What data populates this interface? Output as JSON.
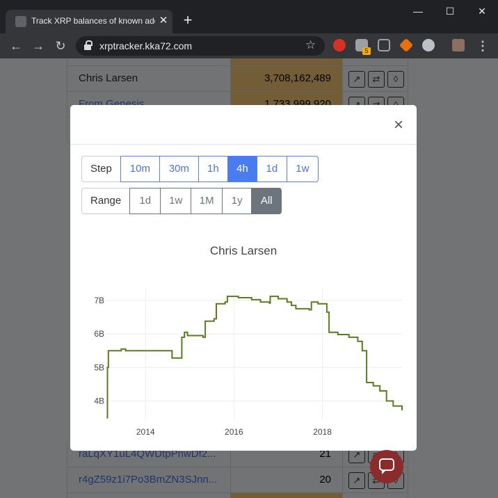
{
  "browser": {
    "tab_title": "Track XRP balances of known addresses",
    "tab_close": "✕",
    "new_tab": "+",
    "url": "xrptracker.kka72.com",
    "extension_badge": "5",
    "window_minimize": "—",
    "window_maximize": "☐",
    "window_close": "✕"
  },
  "table": {
    "rows": [
      {
        "name": "Chris Larsen",
        "balance": "3,708,162,489",
        "highlight": true,
        "link": false
      },
      {
        "name": "From Genesis",
        "balance": "1,733,999,920",
        "highlight": true,
        "link": true
      },
      {
        "name": "raLqXY1uL4QWDtpPnwDf2...",
        "balance": "21",
        "highlight": false,
        "link": true
      },
      {
        "name": "r4gZ59z1i7Po3BmZN3SJnn...",
        "balance": "20",
        "highlight": false,
        "link": true
      }
    ]
  },
  "modal": {
    "close": "×",
    "step": {
      "label": "Step",
      "options": [
        "10m",
        "30m",
        "1h",
        "4h",
        "1d",
        "1w"
      ],
      "selected": "4h"
    },
    "range": {
      "label": "Range",
      "options": [
        "1d",
        "1w",
        "1M",
        "1y",
        "All"
      ],
      "selected": "All"
    }
  },
  "chart_data": {
    "type": "line",
    "title": "Chris Larsen",
    "line_color": "#5a7d1e",
    "x_ticks": [
      "2014",
      "2016",
      "2018"
    ],
    "y_ticks": [
      "4B",
      "5B",
      "6B",
      "7B"
    ],
    "x_unit": "year",
    "y_unit": "billions XRP",
    "xlim": [
      2013.1,
      2019.8
    ],
    "ylim": [
      3.45,
      7.35
    ],
    "grid": true,
    "series": [
      {
        "values": [
          [
            2013.12,
            3.5
          ],
          [
            2013.14,
            5.0
          ],
          [
            2013.16,
            5.5
          ],
          [
            2013.45,
            5.55
          ],
          [
            2013.55,
            5.5
          ],
          [
            2014.2,
            5.5
          ],
          [
            2014.55,
            5.5
          ],
          [
            2014.6,
            5.28
          ],
          [
            2014.8,
            5.28
          ],
          [
            2014.82,
            5.9
          ],
          [
            2014.88,
            6.05
          ],
          [
            2014.95,
            5.95
          ],
          [
            2015.3,
            5.9
          ],
          [
            2015.35,
            6.38
          ],
          [
            2015.5,
            6.38
          ],
          [
            2015.55,
            6.45
          ],
          [
            2015.6,
            6.9
          ],
          [
            2015.8,
            6.95
          ],
          [
            2015.85,
            7.12
          ],
          [
            2016.1,
            7.08
          ],
          [
            2016.4,
            7.02
          ],
          [
            2016.6,
            6.95
          ],
          [
            2016.8,
            6.92
          ],
          [
            2016.82,
            7.12
          ],
          [
            2017.0,
            7.05
          ],
          [
            2017.2,
            6.95
          ],
          [
            2017.3,
            6.85
          ],
          [
            2017.4,
            6.75
          ],
          [
            2017.7,
            6.72
          ],
          [
            2017.75,
            6.95
          ],
          [
            2017.9,
            6.9
          ],
          [
            2018.1,
            6.65
          ],
          [
            2018.15,
            6.05
          ],
          [
            2018.35,
            5.98
          ],
          [
            2018.6,
            5.9
          ],
          [
            2018.8,
            5.78
          ],
          [
            2018.9,
            5.5
          ],
          [
            2019.0,
            4.55
          ],
          [
            2019.15,
            4.45
          ],
          [
            2019.3,
            4.3
          ],
          [
            2019.45,
            4.0
          ],
          [
            2019.6,
            3.85
          ],
          [
            2019.8,
            3.72
          ]
        ]
      }
    ]
  }
}
